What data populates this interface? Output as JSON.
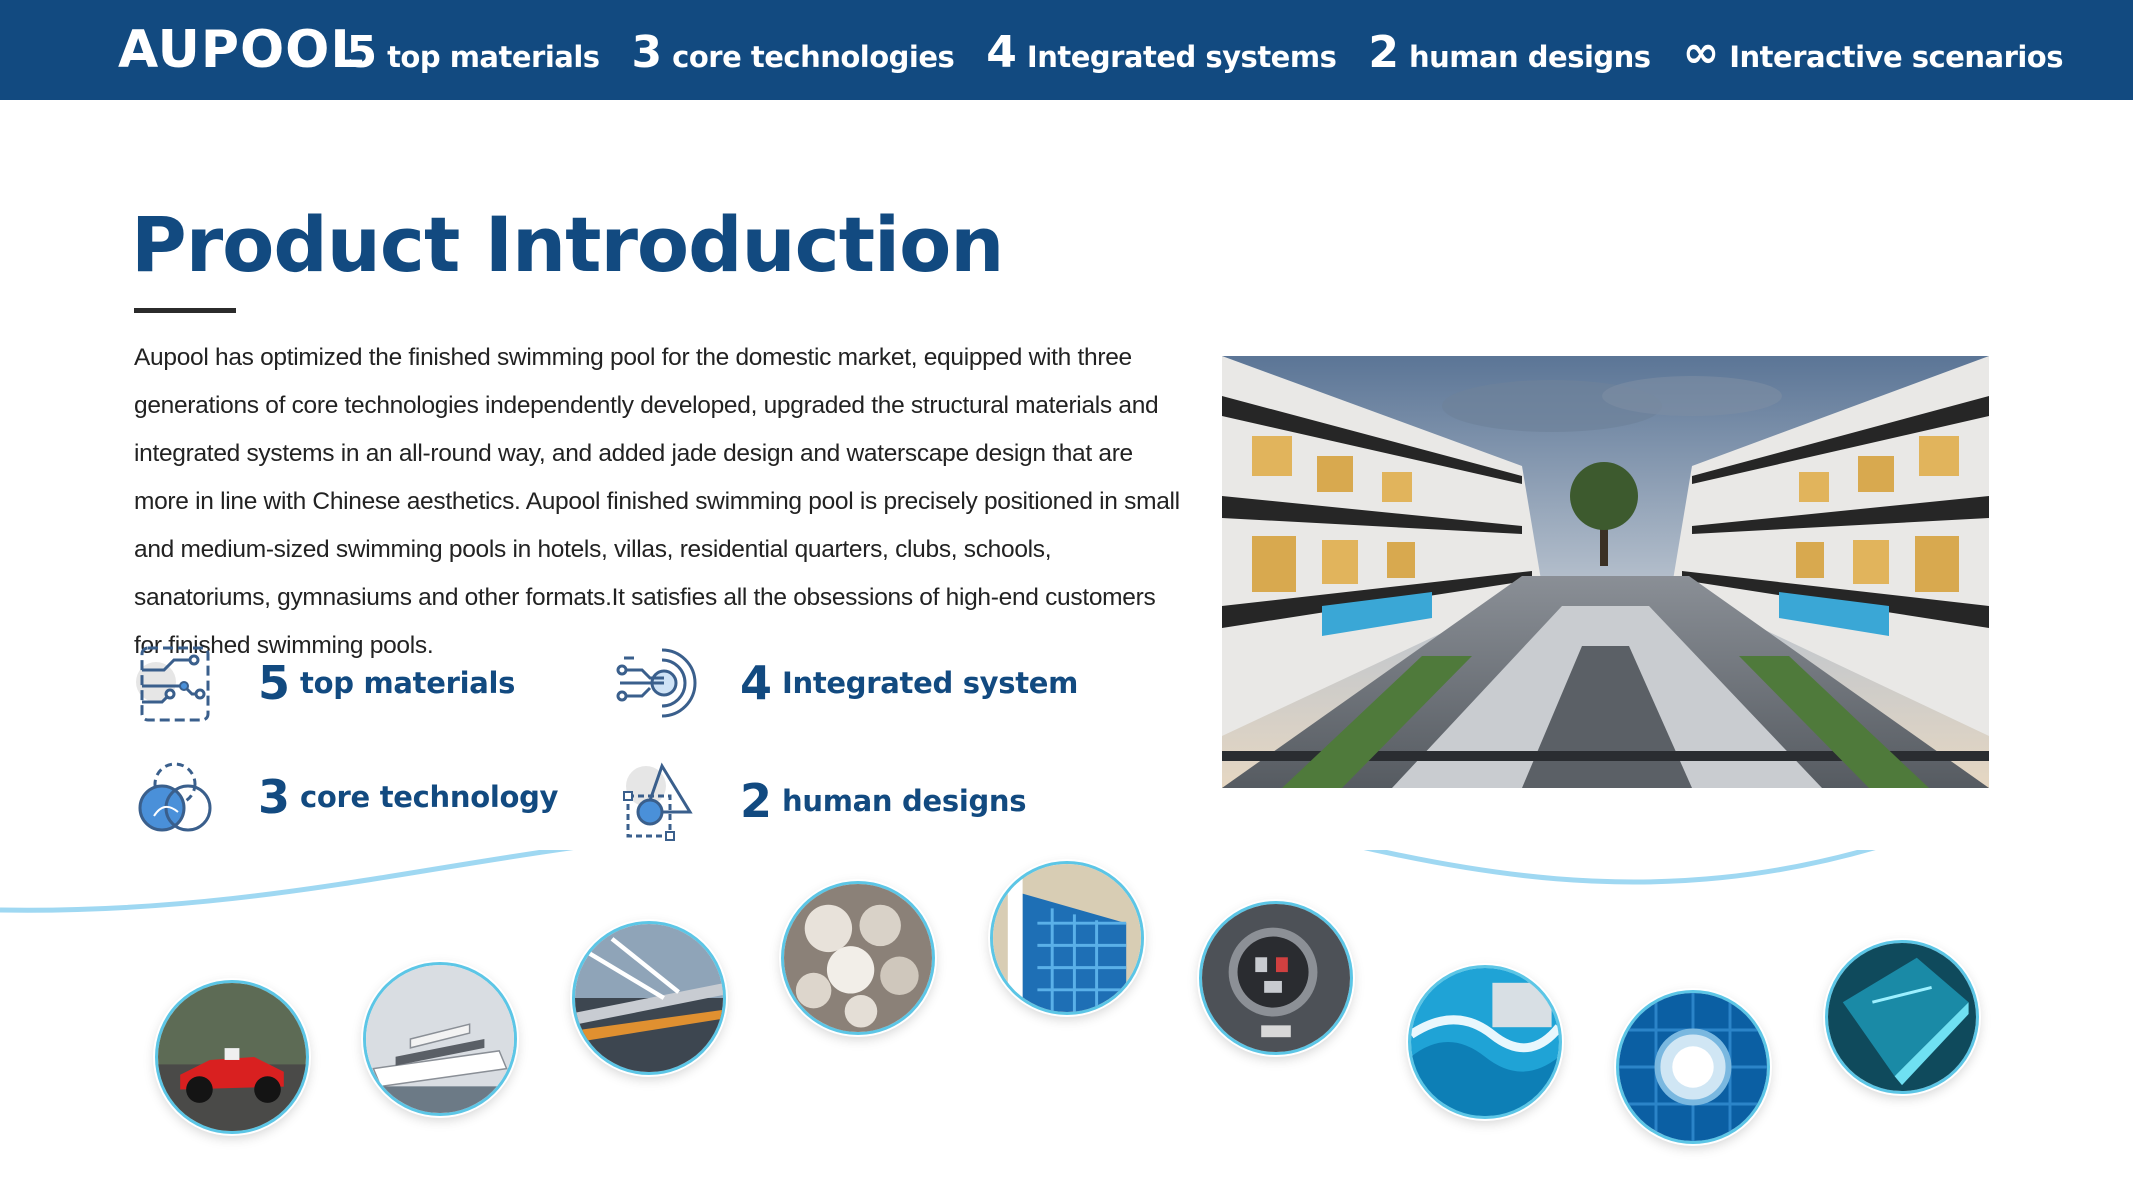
{
  "header": {
    "logo": "AUPOOL",
    "nav": [
      {
        "num": "5",
        "label": "top materials"
      },
      {
        "num": "3",
        "label": "core technologies"
      },
      {
        "num": "4",
        "label": "Integrated systems"
      },
      {
        "num": "2",
        "label": "human designs"
      },
      {
        "num": "∞",
        "label": "Interactive scenarios"
      }
    ]
  },
  "main": {
    "title": "Product Introduction",
    "intro": "Aupool has optimized the finished swimming pool for the domestic market, equipped with three generations of core technologies independently developed, upgraded the structural materials and integrated systems in an all-round way, and added jade design and waterscape design that are more in line with Chinese aesthetics. Aupool finished swimming pool is precisely positioned in small and medium-sized swimming pools in hotels, villas, residential quarters, clubs, schools, sanatoriums, gymnasiums and other formats.It satisfies all the obsessions of high-end customers for finished swimming pools.",
    "features": [
      {
        "num": "5",
        "label": "top materials",
        "icon": "circuit-board-icon"
      },
      {
        "num": "4",
        "label": "Integrated system",
        "icon": "target-circuit-icon"
      },
      {
        "num": "3",
        "label": "core technology",
        "icon": "overlapping-circles-icon"
      },
      {
        "num": "2",
        "label": "human designs",
        "icon": "shapes-design-icon"
      }
    ]
  },
  "gallery": [
    {
      "icon": "race-car-icon"
    },
    {
      "icon": "yacht-icon"
    },
    {
      "icon": "bridge-icon"
    },
    {
      "icon": "crystal-beads-icon"
    },
    {
      "icon": "mosaic-tile-icon"
    },
    {
      "icon": "control-panel-icon"
    },
    {
      "icon": "water-wave-icon"
    },
    {
      "icon": "pool-light-icon"
    },
    {
      "icon": "glass-panel-icon"
    }
  ],
  "colors": {
    "brand": "#124a80",
    "header_bg": "#124a80",
    "accent_cyan": "#5cc6e6",
    "text": "#222222"
  }
}
